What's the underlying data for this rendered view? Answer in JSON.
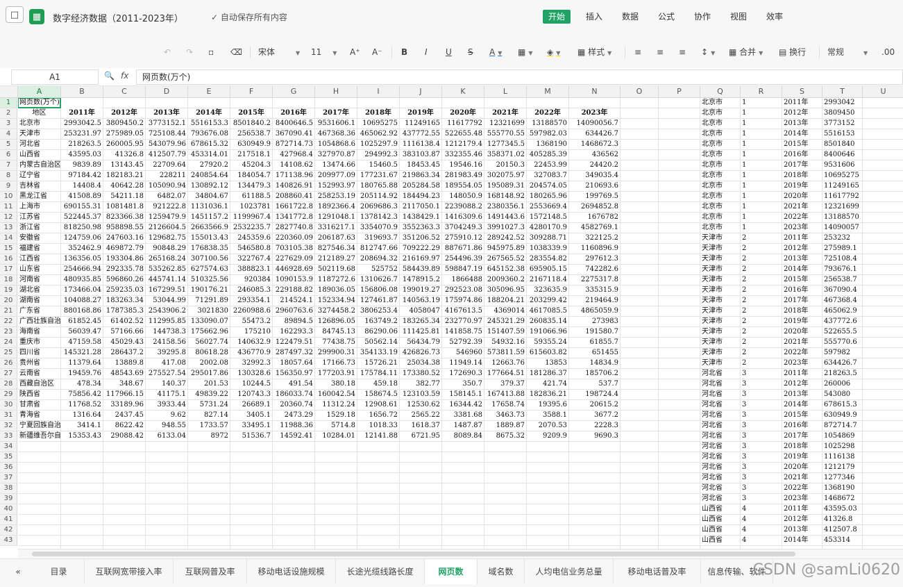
{
  "window": {
    "title": "数字经济数据（2011-2023年）",
    "autosave": "自动保存所有内容"
  },
  "icons": {
    "save": "save-icon",
    "logo": "sheet-logo-icon"
  },
  "menu": [
    "开始",
    "插入",
    "数据",
    "公式",
    "协作",
    "视图",
    "效率"
  ],
  "toolbar": {
    "font": "宋体",
    "size": "11",
    "style": "样式",
    "merge": "合并",
    "wrap": "换行",
    "format": "常规"
  },
  "formula_bar": {
    "cell": "A1",
    "fx": "fx",
    "content": "网页数(万个)"
  },
  "columns": [
    "A",
    "B",
    "C",
    "D",
    "E",
    "F",
    "G",
    "H",
    "I",
    "J",
    "K",
    "L",
    "M",
    "N",
    "O",
    "P",
    "Q",
    "R",
    "S",
    "T",
    "U"
  ],
  "title_cell": "网页数(万个)",
  "header_label": "地区",
  "years": [
    "2011年",
    "2012年",
    "2013年",
    "2014年",
    "2015年",
    "2016年",
    "2017年",
    "2018年",
    "2019年",
    "2020年",
    "2021年",
    "2022年",
    "2023年"
  ],
  "rows": [
    [
      "北京市",
      "2993042.5",
      "3809450.2",
      "3773152.1",
      "5516153.3",
      "8501840.2",
      "8400646.5",
      "9531606.1",
      "10695275",
      "11249165",
      "11617792",
      "12321699",
      "13188570",
      "14090056.7"
    ],
    [
      "天津市",
      "253231.97",
      "275989.05",
      "725108.44",
      "793676.08",
      "256538.7",
      "367090.41",
      "467368.36",
      "465062.92",
      "437772.55",
      "522655.48",
      "555770.55",
      "597982.03",
      "634426.7"
    ],
    [
      "河北省",
      "218263.5",
      "260005.95",
      "543079.96",
      "678615.32",
      "630949.9",
      "872714.73",
      "1054868.6",
      "1025297.9",
      "1116138.4",
      "1212179.4",
      "1277345.5",
      "1368190",
      "1468672.3"
    ],
    [
      "山西省",
      "43595.03",
      "41326.8",
      "412507.79",
      "453314.01",
      "217518.1",
      "427968.4",
      "327970.87",
      "294992.3",
      "383103.87",
      "332355.46",
      "358371.02",
      "405285.39",
      "436562"
    ],
    [
      "内蒙古自治区",
      "9839.89",
      "13143.45",
      "22709.64",
      "27920.2",
      "45204.3",
      "14108.62",
      "13474.66",
      "15460.5",
      "18453.45",
      "19546.16",
      "20150.3",
      "22453.99",
      "24420.2"
    ],
    [
      "辽宁省",
      "97184.42",
      "182183.21",
      "228211",
      "240854.64",
      "184054.7",
      "171138.96",
      "209977.09",
      "177231.67",
      "219863.34",
      "281983.49",
      "302075.97",
      "327083.7",
      "349035.4"
    ],
    [
      "吉林省",
      "14408.4",
      "40642.28",
      "105090.94",
      "130892.12",
      "134479.3",
      "140826.91",
      "152993.97",
      "180765.88",
      "205284.58",
      "189554.05",
      "195089.31",
      "204574.05",
      "210693.6"
    ],
    [
      "黑龙江省",
      "41508.89",
      "54211.18",
      "6482.07",
      "34804.67",
      "61188.5",
      "208860.41",
      "258253.19",
      "205114.92",
      "184494.23",
      "148050.9",
      "168148.92",
      "180265.96",
      "199769.5"
    ],
    [
      "上海市",
      "690155.31",
      "1081481.8",
      "921222.8",
      "1131036.1",
      "1023781",
      "1661722.8",
      "1892366.4",
      "2069686.3",
      "2117050.1",
      "2239088.2",
      "2380356.1",
      "2553669.4",
      "2694852.8"
    ],
    [
      "江苏省",
      "522445.37",
      "823366.38",
      "1259479.9",
      "1451157.2",
      "1199967.4",
      "1341772.8",
      "1291048.1",
      "1378142.3",
      "1438429.1",
      "1416309.6",
      "1491443.6",
      "1572148.5",
      "1676782"
    ],
    [
      "浙江省",
      "818250.98",
      "958898.55",
      "2126604.5",
      "2663566.9",
      "2532235.7",
      "2827740.8",
      "3316217.1",
      "3354070.9",
      "3552363.3",
      "3704249.3",
      "3991027.3",
      "4280170.9",
      "4582769.1"
    ],
    [
      "安徽省",
      "124759.06",
      "247603.16",
      "129682.75",
      "155013.43",
      "245359.6",
      "220360.09",
      "206187.63",
      "319693.7",
      "351206.52",
      "275910.12",
      "289242.52",
      "309288.71",
      "322125.2"
    ],
    [
      "福建省",
      "352462.9",
      "469872.79",
      "90848.29",
      "176838.35",
      "546580.8",
      "703105.38",
      "827546.34",
      "812747.66",
      "709222.29",
      "887671.86",
      "945975.89",
      "1038339.9",
      "1160896.9"
    ],
    [
      "江西省",
      "136356.05",
      "193304.86",
      "265168.24",
      "307100.56",
      "322767.4",
      "227629.09",
      "212189.27",
      "208694.32",
      "216169.97",
      "254496.39",
      "267565.52",
      "283554.82",
      "297612.3"
    ],
    [
      "山东省",
      "254666.94",
      "292335.78",
      "535262.85",
      "627574.63",
      "388823.1",
      "446928.69",
      "502119.68",
      "525752",
      "584439.89",
      "598847.19",
      "645152.38",
      "695905.15",
      "742282.6"
    ],
    [
      "河南省",
      "480935.85",
      "596860.26",
      "445741.14",
      "510325.56",
      "920384",
      "1090153.9",
      "1187272.6",
      "1310626.7",
      "1478915.2",
      "1866488",
      "2009360.2",
      "2167118.4",
      "2275317.8"
    ],
    [
      "湖北省",
      "173466.04",
      "259235.03",
      "167299.51",
      "190176.21",
      "246085.3",
      "229188.82",
      "189036.05",
      "156806.08",
      "199019.27",
      "292523.08",
      "305096.95",
      "323635.9",
      "335315.9"
    ],
    [
      "湖南省",
      "104088.27",
      "183263.34",
      "53044.99",
      "71291.89",
      "293354.1",
      "214524.1",
      "152334.94",
      "127461.87",
      "140563.19",
      "175974.86",
      "188204.21",
      "203299.42",
      "219464.9"
    ],
    [
      "广东省",
      "880168.86",
      "1787385.3",
      "2543906.2",
      "3021830",
      "2260988.6",
      "2960763.6",
      "3274458.2",
      "3806253.4",
      "4058047",
      "4167613.5",
      "4369014",
      "4617085.5",
      "4865059.9"
    ],
    [
      "广西壮族自治区",
      "61852.45",
      "61402.52",
      "112995.85",
      "133090.07",
      "55473.2",
      "89894.5",
      "126896.05",
      "163749.2",
      "183265.34",
      "232770.97",
      "245321.29",
      "260835.14",
      "273983"
    ],
    [
      "海南省",
      "56039.47",
      "57166.66",
      "144738.3",
      "175662.96",
      "175210",
      "162293.3",
      "84745.13",
      "86290.06",
      "111425.81",
      "141858.75",
      "151407.59",
      "191066.96",
      "191580.7"
    ],
    [
      "重庆市",
      "47159.58",
      "45029.43",
      "24158.56",
      "56027.74",
      "140632.9",
      "122479.51",
      "77438.75",
      "50562.14",
      "56434.79",
      "52792.39",
      "54932.16",
      "59355.24",
      "61855.7"
    ],
    [
      "四川省",
      "145321.28",
      "286437.2",
      "39295.8",
      "80618.28",
      "436770.9",
      "287497.32",
      "299900.31",
      "354133.19",
      "426826.73",
      "546960",
      "573811.59",
      "615603.82",
      "651455"
    ],
    [
      "贵州省",
      "11379.64",
      "13889.8",
      "417.08",
      "2002.08",
      "32992.3",
      "18057.64",
      "17166.73",
      "15726.21",
      "25034.38",
      "11949.14",
      "12663.76",
      "13853",
      "14834.9"
    ],
    [
      "云南省",
      "19459.76",
      "48543.69",
      "275527.54",
      "295017.86",
      "130328.6",
      "156350.97",
      "177203.91",
      "175784.11",
      "173380.52",
      "172690.3",
      "177664.51",
      "181286.37",
      "185706.2"
    ],
    [
      "西藏自治区",
      "478.34",
      "348.67",
      "140.37",
      "201.53",
      "10244.5",
      "491.54",
      "380.18",
      "459.18",
      "382.77",
      "350.7",
      "379.37",
      "421.74",
      "537.7"
    ],
    [
      "陕西省",
      "75856.42",
      "117966.15",
      "41175.1",
      "49839.22",
      "120743.3",
      "186033.74",
      "160042.54",
      "158674.5",
      "123103.59",
      "158145.1",
      "167413.88",
      "182836.21",
      "198724.4"
    ],
    [
      "甘肃省",
      "11768.52",
      "33189.96",
      "3933.44",
      "5731.24",
      "26689.1",
      "20360.74",
      "11312.24",
      "12908.61",
      "12530.62",
      "16344.42",
      "17658.74",
      "19395.6",
      "20615.2"
    ],
    [
      "青海省",
      "1316.64",
      "2437.45",
      "9.62",
      "827.14",
      "3405.1",
      "2473.29",
      "1529.18",
      "1656.72",
      "2565.22",
      "3381.68",
      "3463.73",
      "3588.1",
      "3677.2"
    ],
    [
      "宁夏回族自治区",
      "3414.1",
      "8622.42",
      "948.55",
      "1733.57",
      "33495.1",
      "11988.36",
      "5714.8",
      "1018.33",
      "1618.37",
      "1487.87",
      "1889.87",
      "2070.53",
      "2228.3"
    ],
    [
      "新疆维吾尔自治区",
      "15353.43",
      "29088.42",
      "6133.04",
      "8972",
      "51536.7",
      "14592.41",
      "10284.01",
      "12141.88",
      "6721.95",
      "8089.84",
      "8675.32",
      "9209.9",
      "9690.3"
    ]
  ],
  "side_rows": [
    [
      "北京市",
      "1",
      "2011年",
      "2993042"
    ],
    [
      "北京市",
      "1",
      "2012年",
      "3809450"
    ],
    [
      "北京市",
      "1",
      "2013年",
      "3773152"
    ],
    [
      "北京市",
      "1",
      "2014年",
      "5516153"
    ],
    [
      "北京市",
      "1",
      "2015年",
      "8501840"
    ],
    [
      "北京市",
      "1",
      "2016年",
      "8400646"
    ],
    [
      "北京市",
      "1",
      "2017年",
      "9531606"
    ],
    [
      "北京市",
      "1",
      "2018年",
      "10695275"
    ],
    [
      "北京市",
      "1",
      "2019年",
      "11249165"
    ],
    [
      "北京市",
      "1",
      "2020年",
      "11617792"
    ],
    [
      "北京市",
      "1",
      "2021年",
      "12321699"
    ],
    [
      "北京市",
      "1",
      "2022年",
      "13188570"
    ],
    [
      "北京市",
      "1",
      "2023年",
      "14090057"
    ],
    [
      "天津市",
      "2",
      "2011年",
      "253232"
    ],
    [
      "天津市",
      "2",
      "2012年",
      "275989.1"
    ],
    [
      "天津市",
      "2",
      "2013年",
      "725108.4"
    ],
    [
      "天津市",
      "2",
      "2014年",
      "793676.1"
    ],
    [
      "天津市",
      "2",
      "2015年",
      "256538.7"
    ],
    [
      "天津市",
      "2",
      "2016年",
      "367090.4"
    ],
    [
      "天津市",
      "2",
      "2017年",
      "467368.4"
    ],
    [
      "天津市",
      "2",
      "2018年",
      "465062.9"
    ],
    [
      "天津市",
      "2",
      "2019年",
      "437772.6"
    ],
    [
      "天津市",
      "2",
      "2020年",
      "522655.5"
    ],
    [
      "天津市",
      "2",
      "2021年",
      "555770.6"
    ],
    [
      "天津市",
      "2",
      "2022年",
      "597982"
    ],
    [
      "天津市",
      "2",
      "2023年",
      "634426.7"
    ],
    [
      "河北省",
      "3",
      "2011年",
      "218263.5"
    ],
    [
      "河北省",
      "3",
      "2012年",
      "260006"
    ],
    [
      "河北省",
      "3",
      "2013年",
      "543080"
    ],
    [
      "河北省",
      "3",
      "2014年",
      "678615.3"
    ],
    [
      "河北省",
      "3",
      "2015年",
      "630949.9"
    ],
    [
      "河北省",
      "3",
      "2016年",
      "872714.7"
    ],
    [
      "河北省",
      "3",
      "2017年",
      "1054869"
    ],
    [
      "河北省",
      "3",
      "2018年",
      "1025298"
    ],
    [
      "河北省",
      "3",
      "2019年",
      "1116138"
    ],
    [
      "河北省",
      "3",
      "2020年",
      "1212179"
    ],
    [
      "河北省",
      "3",
      "2021年",
      "1277346"
    ],
    [
      "河北省",
      "3",
      "2022年",
      "1368190"
    ],
    [
      "河北省",
      "3",
      "2023年",
      "1468672"
    ],
    [
      "山西省",
      "4",
      "2011年",
      "43595.03"
    ],
    [
      "山西省",
      "4",
      "2012年",
      "41326.8"
    ],
    [
      "山西省",
      "4",
      "2013年",
      "412507.8"
    ],
    [
      "山西省",
      "4",
      "2014年",
      "453314"
    ]
  ],
  "sheet_tabs": [
    "目录",
    "互联网宽带接入率",
    "互联网普及率",
    "移动电话设施规模",
    "长途光缆线路长度",
    "网页数",
    "域名数",
    "人均电信业务总量",
    "移动电话普及率",
    "信息传输、软件"
  ],
  "active_tab": "网页数",
  "watermark": "CSDN @samLi0620"
}
